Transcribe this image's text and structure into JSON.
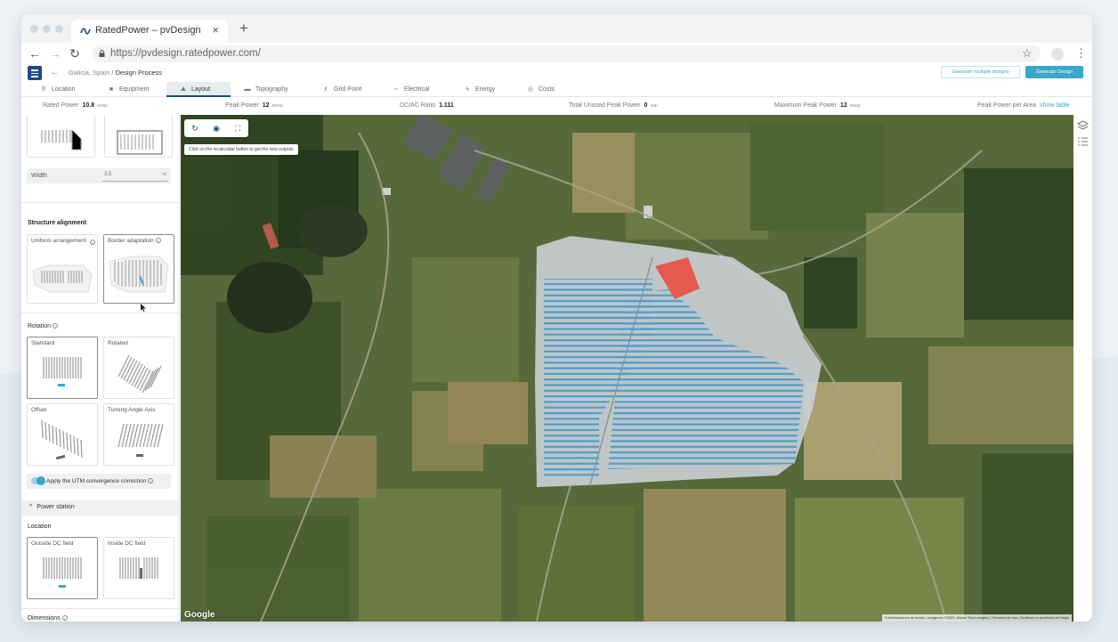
{
  "browser": {
    "tab_title": "RatedPower – pvDesign",
    "tab_close": "×",
    "new_tab": "+",
    "url": "https://pvdesign.ratedpower.com/",
    "icons": [
      "back-arrow-icon",
      "forward-arrow-icon",
      "reload-icon",
      "lock-icon",
      "star-icon",
      "kebab-menu-icon"
    ]
  },
  "header": {
    "breadcrumb_location": "Galicia, Spain",
    "breadcrumb_separator": "/",
    "breadcrumb_current": "Design Process",
    "generate_multiple": "Generate multiple designs",
    "generate": "Generate Design"
  },
  "nav_tabs": [
    {
      "label": "Location",
      "icon": "pin-icon",
      "glyph": "⚲"
    },
    {
      "label": "Equipment",
      "icon": "panel-icon",
      "glyph": "■"
    },
    {
      "label": "Layout",
      "icon": "mountain-icon",
      "glyph": "⛰",
      "active": true
    },
    {
      "label": "Topography",
      "icon": "topography-icon",
      "glyph": "▬"
    },
    {
      "label": "Grid Point",
      "icon": "tower-icon",
      "glyph": "♗"
    },
    {
      "label": "Electrical",
      "icon": "electrical-icon",
      "glyph": "⌐"
    },
    {
      "label": "Energy",
      "icon": "bolt-icon",
      "glyph": "ϟ"
    },
    {
      "label": "Costs",
      "icon": "coin-icon",
      "glyph": "◎"
    }
  ],
  "stats": {
    "rated_power": {
      "label": "Rated Power",
      "value": "10.8",
      "unit": "MWac"
    },
    "peak_power": {
      "label": "Peak Power",
      "value": "12",
      "unit": "MWdc"
    },
    "dcac": {
      "label": "DC/AC Ratio",
      "value": "1.111"
    },
    "unused": {
      "label": "Total Unused Peak Power",
      "value": "0",
      "unit": "Wdc"
    },
    "max_peak": {
      "label": "Maximum Peak Power",
      "value": "12",
      "unit": "MWdc"
    },
    "per_area": {
      "label": "Peak Power per Area",
      "link": "show table"
    }
  },
  "sidebar": {
    "width": {
      "label": "Width",
      "value": "3,5",
      "unit": "m"
    },
    "structure_alignment": {
      "title": "Structure alignment",
      "options": [
        {
          "label": "Uniform arrangement",
          "info": "i"
        },
        {
          "label": "Border adaptation",
          "info": "i",
          "selected": true
        }
      ]
    },
    "rotation": {
      "title": "Rotation",
      "info": "i",
      "options": [
        {
          "label": "Standard",
          "selected": true
        },
        {
          "label": "Rotated"
        },
        {
          "label": "Offset"
        },
        {
          "label": "Turning Angle Axis"
        }
      ]
    },
    "utm_toggle": {
      "label": "Apply the UTM convergence correction",
      "info": "i",
      "on": true
    },
    "power_station": {
      "label": "Power station",
      "chevron": "^"
    },
    "location": {
      "title": "Location",
      "options": [
        {
          "label": "Outside DC field",
          "selected": true
        },
        {
          "label": "Inside DC field"
        }
      ]
    },
    "dimensions": {
      "title": "Dimensions",
      "info": "i"
    }
  },
  "map": {
    "tooltip": "Click on the recalculate button to get the new outputs",
    "tools": [
      {
        "name": "recalculate-icon",
        "glyph": "↻"
      },
      {
        "name": "target-icon",
        "glyph": "◉"
      },
      {
        "name": "fullscreen-icon",
        "glyph": "⛶"
      }
    ],
    "google": "Google",
    "attribution": "Combinaciones de teclas | Imágenes ©2022, Maxar Technologies | Términos de uso | Notificar un problema de Maps"
  },
  "colors": {
    "brand": "#1b4b86",
    "accent": "#3aa7c9",
    "pv_rows": "#4b9fd0",
    "power_station": "#e8534a"
  },
  "right_rail": [
    "layers-icon",
    "list-icon"
  ]
}
